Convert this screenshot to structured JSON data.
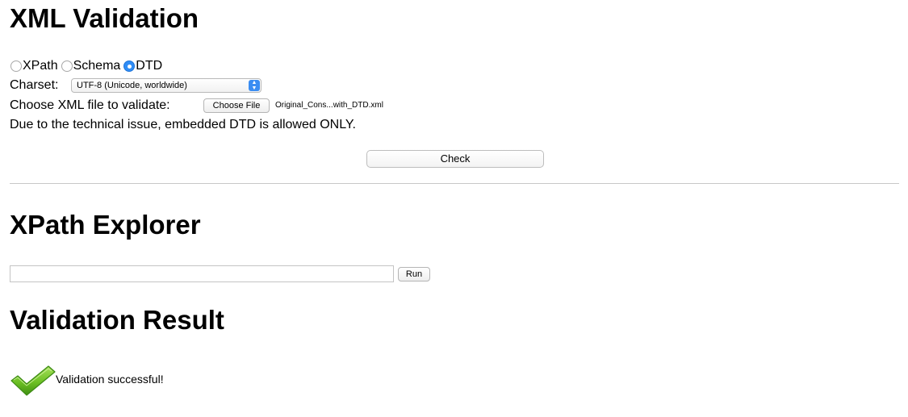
{
  "validation": {
    "title": "XML Validation",
    "radio_options": [
      {
        "label": "XPath",
        "checked": false
      },
      {
        "label": "Schema",
        "checked": false
      },
      {
        "label": "DTD",
        "checked": true
      }
    ],
    "charset_label": "Charset:",
    "charset_value": "UTF-8 (Unicode, worldwide)",
    "file_label": "Choose XML file to validate:",
    "file_button": "Choose File",
    "file_name": "Original_Cons...with_DTD.xml",
    "notice": "Due to the technical issue, embedded DTD is allowed ONLY.",
    "check_button": "Check"
  },
  "explorer": {
    "title": "XPath Explorer",
    "input_value": "",
    "run_button": "Run"
  },
  "result": {
    "title": "Validation Result",
    "icon": "checkmark-icon",
    "message": "Validation successful!"
  },
  "colors": {
    "radio_selected": "#2f8df6",
    "select_arrow": "#3b8df2",
    "checkmark": "#6cc024",
    "divider": "#c8c8c8"
  }
}
